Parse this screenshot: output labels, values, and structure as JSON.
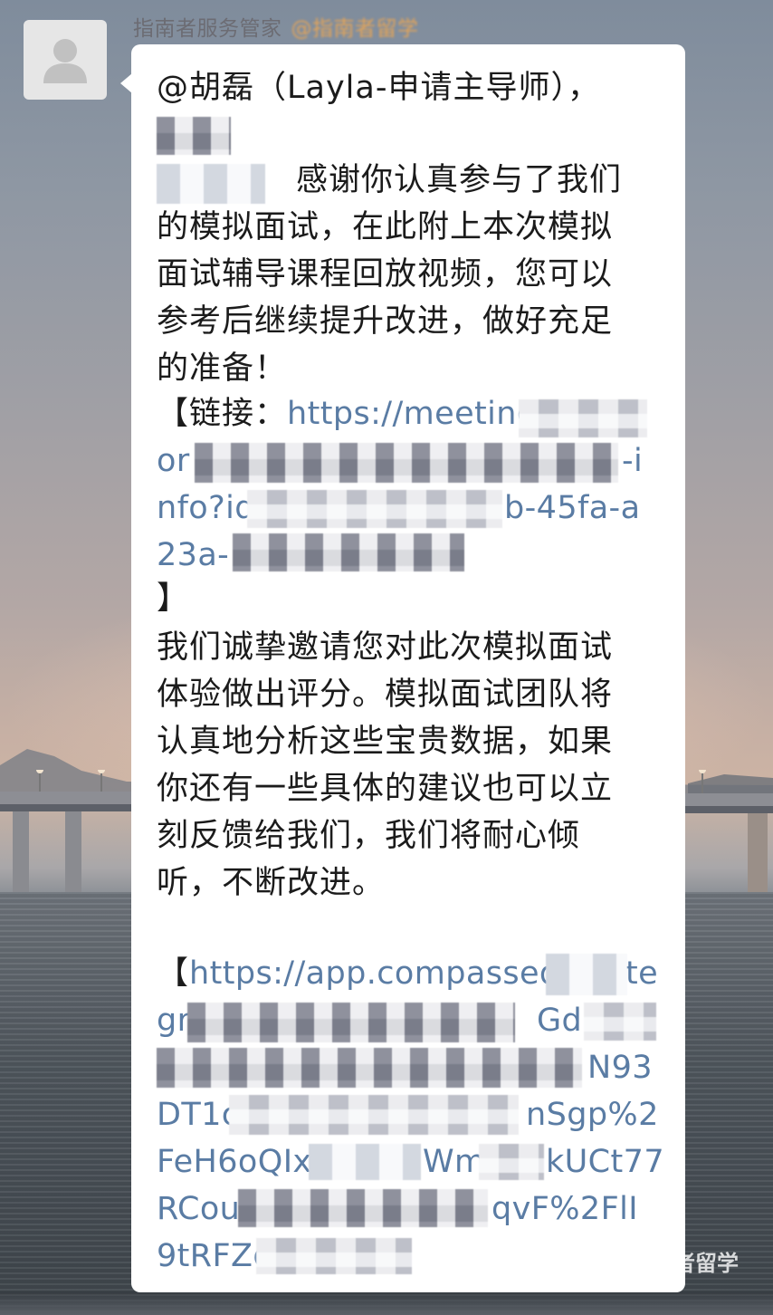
{
  "chat": {
    "sender_name": "指南者服务管家",
    "sender_tag": "@指南者留学"
  },
  "message": {
    "mention": "@胡磊（Layla-申请主导师），",
    "lines": [
      "感谢你认真参与了我们",
      "的模拟面试，在此附上本次模拟",
      "面试辅导课程回放视频，您可以",
      "参考后继续提升改进，做好充足",
      "的准备！"
    ],
    "link1_prefix": "【链接：",
    "link1_lines": [
      "https://meeting.t",
      "or",
      "-i",
      "nfo?id",
      "b-45fa-a",
      "23a-"
    ],
    "link1_close": "】",
    "invite_lines": [
      "我们诚挚邀请您对此次模拟面试",
      "体验做出评分。模拟面试团队将",
      "认真地分析这些宝贵数据，如果",
      "你还有一些具体的建议也可以立",
      "刻反馈给我们，我们将耐心倾",
      "听，不断改进。"
    ],
    "link2_open": "【",
    "link2_lines": [
      "https://app.compassedu",
      "te",
      "gr",
      "Gd",
      "N93",
      "DT1c",
      "nSgp%2",
      "FeH6oQIx",
      "Wm",
      "kUCt77",
      "RCou",
      "qvF%2FlI",
      "9tRFZo"
    ]
  },
  "watermark": "者留学"
}
